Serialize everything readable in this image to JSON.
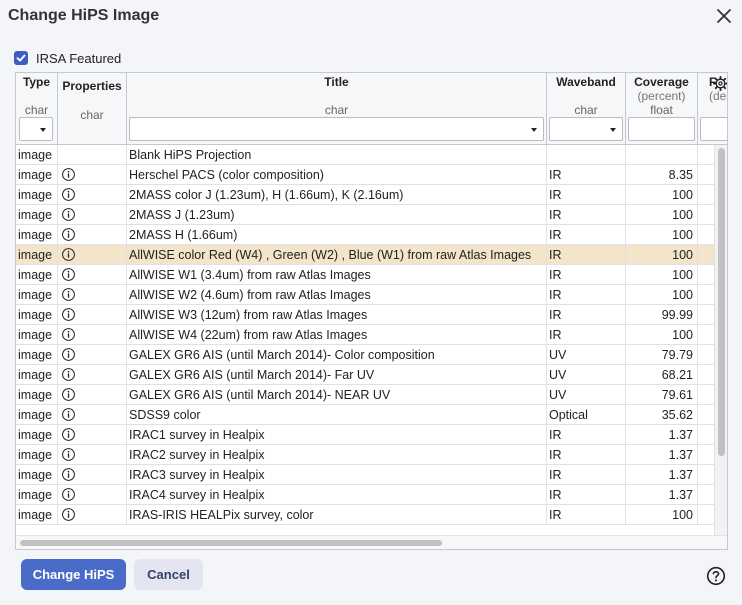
{
  "dialog": {
    "title": "Change HiPS Image"
  },
  "featured": {
    "label": "IRSA Featured",
    "checked": true
  },
  "table": {
    "columns": [
      {
        "name": "Type",
        "unit": "",
        "type": "char"
      },
      {
        "name": "Properties",
        "unit": "",
        "type": "char"
      },
      {
        "name": "Title",
        "unit": "",
        "type": "char"
      },
      {
        "name": "Waveband",
        "unit": "",
        "type": "char"
      },
      {
        "name": "Coverage",
        "unit": "(percent)",
        "type": "float"
      },
      {
        "name": "F",
        "unit": "(de",
        "type": ""
      }
    ],
    "selected_row": 5,
    "rows": [
      {
        "type": "image",
        "props": false,
        "title": "Blank HiPS Projection",
        "waveband": "",
        "coverage": ""
      },
      {
        "type": "image",
        "props": true,
        "title": "Herschel PACS (color composition)",
        "waveband": "IR",
        "coverage": "8.35"
      },
      {
        "type": "image",
        "props": true,
        "title": "2MASS color J (1.23um), H (1.66um), K (2.16um)",
        "waveband": "IR",
        "coverage": "100"
      },
      {
        "type": "image",
        "props": true,
        "title": "2MASS J (1.23um)",
        "waveband": "IR",
        "coverage": "100"
      },
      {
        "type": "image",
        "props": true,
        "title": "2MASS H (1.66um)",
        "waveband": "IR",
        "coverage": "100"
      },
      {
        "type": "image",
        "props": true,
        "title": "AllWISE color Red (W4) , Green (W2) , Blue (W1) from raw Atlas Images",
        "waveband": "IR",
        "coverage": "100"
      },
      {
        "type": "image",
        "props": true,
        "title": "AllWISE W1 (3.4um) from raw Atlas Images",
        "waveband": "IR",
        "coverage": "100"
      },
      {
        "type": "image",
        "props": true,
        "title": "AllWISE W2 (4.6um) from raw Atlas Images",
        "waveband": "IR",
        "coverage": "100"
      },
      {
        "type": "image",
        "props": true,
        "title": "AllWISE W3 (12um) from raw Atlas Images",
        "waveband": "IR",
        "coverage": "99.99"
      },
      {
        "type": "image",
        "props": true,
        "title": "AllWISE W4 (22um) from raw Atlas Images",
        "waveband": "IR",
        "coverage": "100"
      },
      {
        "type": "image",
        "props": true,
        "title": "GALEX GR6 AIS (until March 2014)- Color composition",
        "waveband": "UV",
        "coverage": "79.79"
      },
      {
        "type": "image",
        "props": true,
        "title": "GALEX GR6 AIS (until March 2014)- Far UV",
        "waveband": "UV",
        "coverage": "68.21"
      },
      {
        "type": "image",
        "props": true,
        "title": "GALEX GR6 AIS (until March 2014)- NEAR UV",
        "waveband": "UV",
        "coverage": "79.61"
      },
      {
        "type": "image",
        "props": true,
        "title": "SDSS9 color",
        "waveband": "Optical",
        "coverage": "35.62"
      },
      {
        "type": "image",
        "props": true,
        "title": "IRAC1 survey in Healpix",
        "waveband": "IR",
        "coverage": "1.37"
      },
      {
        "type": "image",
        "props": true,
        "title": "IRAC2 survey in Healpix",
        "waveband": "IR",
        "coverage": "1.37"
      },
      {
        "type": "image",
        "props": true,
        "title": "IRAC3 survey in Healpix",
        "waveband": "IR",
        "coverage": "1.37"
      },
      {
        "type": "image",
        "props": true,
        "title": "IRAC4 survey in Healpix",
        "waveband": "IR",
        "coverage": "1.37"
      },
      {
        "type": "image",
        "props": true,
        "title": "IRAS-IRIS HEALPix survey, color",
        "waveband": "IR",
        "coverage": "100"
      }
    ]
  },
  "buttons": {
    "change": "Change HiPS",
    "cancel": "Cancel"
  },
  "icons": {
    "close": "close-icon",
    "settings": "gear-icon",
    "info": "info-icon",
    "help": "help-icon",
    "checkbox": "check-icon"
  },
  "colors": {
    "primary": "#4a6cc8",
    "selected_row": "#f3e5c9",
    "checkbox": "#3b5ec2"
  }
}
